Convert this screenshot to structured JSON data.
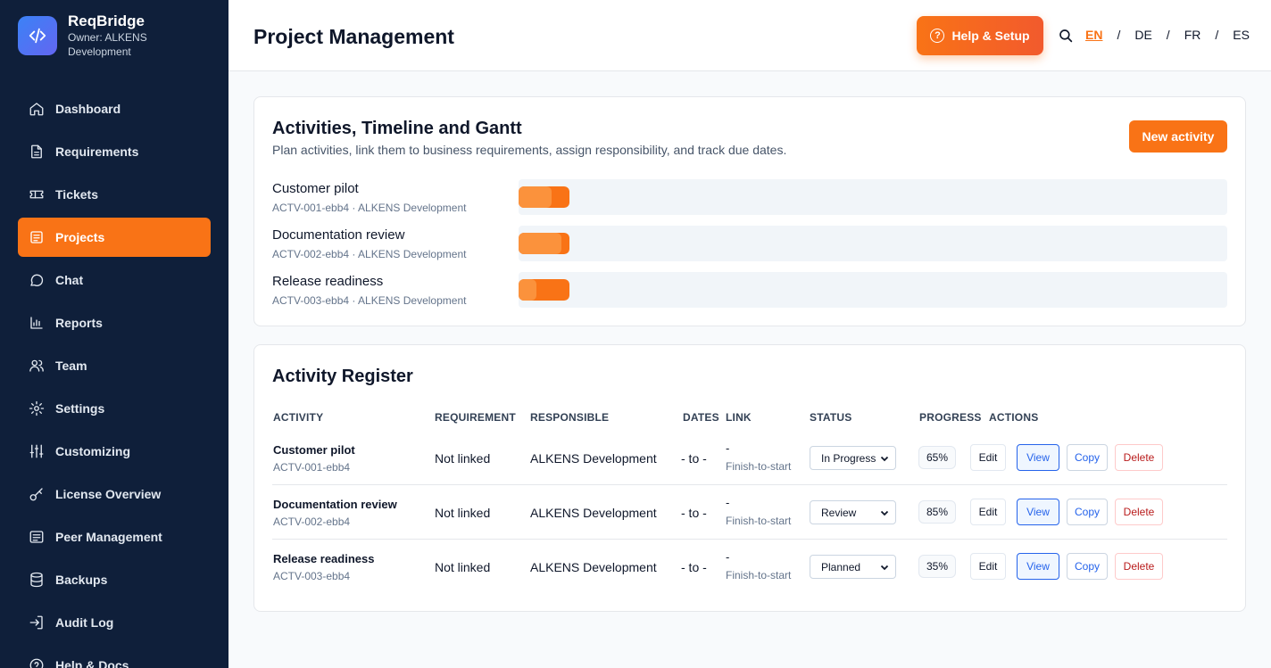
{
  "brand": {
    "name": "ReqBridge",
    "owner": "Owner: ALKENS Development",
    "logo_icon": "code-icon"
  },
  "sidebar": {
    "items": [
      {
        "label": "Dashboard",
        "icon": "home-icon",
        "active": false
      },
      {
        "label": "Requirements",
        "icon": "document-icon",
        "active": false
      },
      {
        "label": "Tickets",
        "icon": "ticket-icon",
        "active": false
      },
      {
        "label": "Projects",
        "icon": "clipboard-icon",
        "active": true
      },
      {
        "label": "Chat",
        "icon": "chat-icon",
        "active": false
      },
      {
        "label": "Reports",
        "icon": "chart-icon",
        "active": false
      },
      {
        "label": "Team",
        "icon": "team-icon",
        "active": false
      },
      {
        "label": "Settings",
        "icon": "gear-icon",
        "active": false
      },
      {
        "label": "Customizing",
        "icon": "sliders-icon",
        "active": false
      },
      {
        "label": "License Overview",
        "icon": "key-icon",
        "active": false
      },
      {
        "label": "Peer Management",
        "icon": "list-icon",
        "active": false
      },
      {
        "label": "Backups",
        "icon": "database-icon",
        "active": false
      },
      {
        "label": "Audit Log",
        "icon": "login-icon",
        "active": false
      },
      {
        "label": "Help & Docs",
        "icon": "help-icon",
        "active": false
      }
    ]
  },
  "header": {
    "title": "Project Management",
    "help_label": "Help & Setup",
    "languages": [
      "EN",
      "DE",
      "FR",
      "ES"
    ],
    "active_language": "EN"
  },
  "timeline": {
    "title": "Activities, Timeline and Gantt",
    "subtitle": "Plan activities, link them to business requirements, assign responsibility, and track due dates.",
    "new_label": "New activity",
    "rows": [
      {
        "name": "Customer pilot",
        "meta": "ACTV-001-ebb4 · ALKENS Development",
        "progress": 0.65
      },
      {
        "name": "Documentation review",
        "meta": "ACTV-002-ebb4 · ALKENS Development",
        "progress": 0.85
      },
      {
        "name": "Release readiness",
        "meta": "ACTV-003-ebb4 · ALKENS Development",
        "progress": 0.35
      }
    ]
  },
  "register": {
    "title": "Activity Register",
    "columns": [
      "ACTIVITY",
      "REQUIREMENT",
      "RESPONSIBLE",
      "DATES",
      "LINK",
      "STATUS",
      "PROGRESS",
      "ACTIONS"
    ],
    "actions": {
      "edit": "Edit",
      "view": "View",
      "copy": "Copy",
      "delete": "Delete"
    },
    "rows": [
      {
        "name": "Customer pilot",
        "id": "ACTV-001-ebb4",
        "requirement": "Not linked",
        "responsible": "ALKENS Development",
        "dates": "- to -",
        "link": "-",
        "link_type": "Finish-to-start",
        "status": "In Progress",
        "progress": "65%"
      },
      {
        "name": "Documentation review",
        "id": "ACTV-002-ebb4",
        "requirement": "Not linked",
        "responsible": "ALKENS Development",
        "dates": "- to -",
        "link": "-",
        "link_type": "Finish-to-start",
        "status": "Review",
        "progress": "85%"
      },
      {
        "name": "Release readiness",
        "id": "ACTV-003-ebb4",
        "requirement": "Not linked",
        "responsible": "ALKENS Development",
        "dates": "- to -",
        "link": "-",
        "link_type": "Finish-to-start",
        "status": "Planned",
        "progress": "35%"
      }
    ]
  },
  "colors": {
    "accent": "#f97316",
    "sidebar": "#0f1f3a",
    "link": "#2563eb",
    "danger": "#b91c1c"
  }
}
